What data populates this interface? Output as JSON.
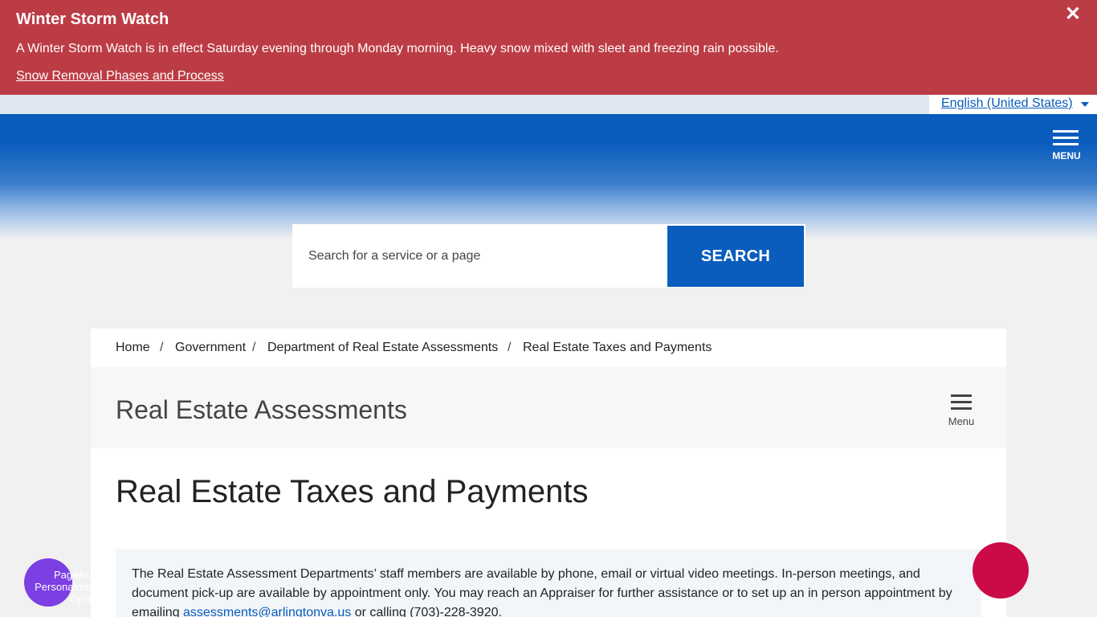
{
  "alert": {
    "title": "Winter Storm Watch",
    "text": "A Winter Storm Watch is in effect Saturday evening through Monday morning. Heavy snow mixed with sleet and freezing rain possible.",
    "link": "Snow Removal Phases and Process",
    "close_icon": "✕"
  },
  "language": {
    "selected": "English (United States)"
  },
  "header": {
    "menu_label": "MENU"
  },
  "search": {
    "placeholder": "Search for a service or a page",
    "button_label": "SEARCH"
  },
  "breadcrumb": {
    "items": [
      "Home",
      "Government",
      "Department of Real Estate Assessments",
      "Real Estate Taxes and Payments"
    ],
    "separator": "/"
  },
  "section": {
    "title": "Real Estate Assessments",
    "menu_label": "Menu"
  },
  "page": {
    "title": "Real Estate Taxes and Payments"
  },
  "notice": {
    "text_before": "The Real Estate Assessment Departments’ staff members are available by phone, email or virtual video meetings. In-person meetings, and document pick-up are available by appointment only. You may reach an Appraiser for further assistance or to set up an in person appointment by emailing ",
    "email": "assessments@arlingtonva.us",
    "text_after": " or calling (703)-228-3920."
  },
  "widgets": {
    "page_assist_alt": "PageAssist Personalization Options"
  },
  "colors": {
    "alert_bg": "#bc3c45",
    "brand_blue": "#0a5cbd",
    "widget_purple": "#7b3fe4",
    "widget_red": "#cc0a47"
  }
}
